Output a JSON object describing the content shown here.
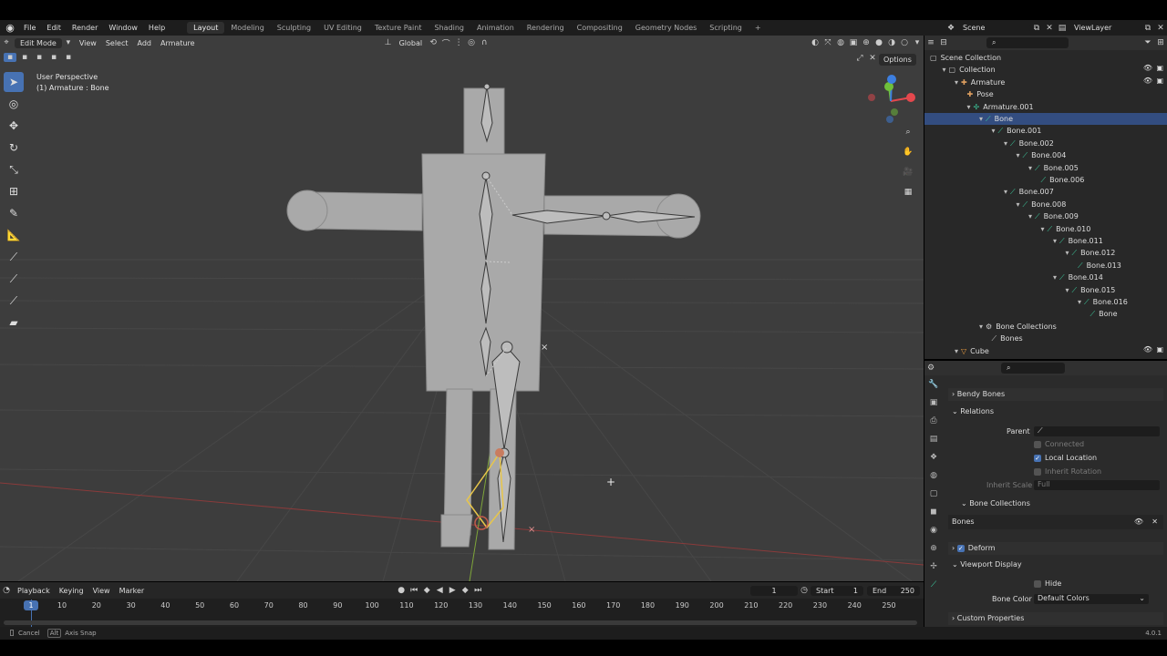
{
  "menu": {
    "items": [
      "File",
      "Edit",
      "Render",
      "Window",
      "Help"
    ],
    "workspaces": [
      "Layout",
      "Modeling",
      "Sculpting",
      "UV Editing",
      "Texture Paint",
      "Shading",
      "Animation",
      "Rendering",
      "Compositing",
      "Geometry Nodes",
      "Scripting"
    ],
    "active_workspace": "Layout",
    "add_tab": "+"
  },
  "scene": {
    "label": "Scene",
    "view_layer": "ViewLayer"
  },
  "viewport": {
    "mode": "Edit Mode",
    "menus": [
      "View",
      "Select",
      "Add",
      "Armature"
    ],
    "orientation": "Global",
    "info_line1": "User Perspective",
    "info_line2": "(1) Armature : Bone",
    "options": "Options",
    "gizmo_x_color": "#e5484d",
    "gizmo_y_color": "#6fbf3a",
    "gizmo_z_color": "#3d7fe0"
  },
  "outliner": {
    "rows": [
      {
        "label": "Scene Collection",
        "depth": 0,
        "icon": "collection-icon"
      },
      {
        "label": "Collection",
        "depth": 1,
        "icon": "collection-icon",
        "arrow": true
      },
      {
        "label": "Armature",
        "depth": 2,
        "icon": "armature-icon",
        "arrow": true
      },
      {
        "label": "Pose",
        "depth": 3,
        "icon": "pose-icon"
      },
      {
        "label": "Armature.001",
        "depth": 3,
        "icon": "armature-data-icon",
        "arrow": true
      },
      {
        "label": "Bone",
        "depth": 4,
        "icon": "bone-icon",
        "arrow": true,
        "selected": true
      },
      {
        "label": "Bone.001",
        "depth": 5,
        "icon": "bone-icon",
        "arrow": true
      },
      {
        "label": "Bone.002",
        "depth": 6,
        "icon": "bone-icon",
        "arrow": true
      },
      {
        "label": "Bone.004",
        "depth": 7,
        "icon": "bone-icon",
        "arrow": true
      },
      {
        "label": "Bone.005",
        "depth": 8,
        "icon": "bone-icon",
        "arrow": true
      },
      {
        "label": "Bone.006",
        "depth": 9,
        "icon": "bone-icon"
      },
      {
        "label": "Bone.007",
        "depth": 6,
        "icon": "bone-icon",
        "arrow": true
      },
      {
        "label": "Bone.008",
        "depth": 7,
        "icon": "bone-icon",
        "arrow": true
      },
      {
        "label": "Bone.009",
        "depth": 8,
        "icon": "bone-icon",
        "arrow": true
      },
      {
        "label": "Bone.010",
        "depth": 9,
        "icon": "bone-icon",
        "arrow": true
      },
      {
        "label": "Bone.011",
        "depth": 10,
        "icon": "bone-icon",
        "arrow": true
      },
      {
        "label": "Bone.012",
        "depth": 11,
        "icon": "bone-icon",
        "arrow": true
      },
      {
        "label": "Bone.013",
        "depth": 12,
        "icon": "bone-icon"
      },
      {
        "label": "Bone.014",
        "depth": 10,
        "icon": "bone-icon",
        "arrow": true
      },
      {
        "label": "Bone.015",
        "depth": 11,
        "icon": "bone-icon",
        "arrow": true
      },
      {
        "label": "Bone.016",
        "depth": 12,
        "icon": "bone-icon",
        "arrow": true
      },
      {
        "label": "Bone",
        "depth": 13,
        "icon": "bone-icon"
      },
      {
        "label": "Bone Collections",
        "depth": 4,
        "icon": "bone-collection-icon",
        "arrow": true
      },
      {
        "label": "Bones",
        "depth": 5,
        "icon": "bones-icon"
      },
      {
        "label": "Cube",
        "depth": 2,
        "icon": "mesh-icon",
        "arrow": true
      }
    ]
  },
  "properties": {
    "bendy_bones": "Bendy Bones",
    "relations": "Relations",
    "parent_label": "Parent",
    "connected": "Connected",
    "local_location": "Local Location",
    "inherit_rotation": "Inherit Rotation",
    "inherit_scale_label": "Inherit Scale",
    "inherit_scale_value": "Full",
    "bone_collections": "Bone Collections",
    "bones_entry": "Bones",
    "deform": "Deform",
    "viewport_display": "Viewport Display",
    "hide": "Hide",
    "bone_color_label": "Bone Color",
    "bone_color_value": "Default Colors",
    "custom_properties": "Custom Properties"
  },
  "timeline": {
    "menus": [
      "Playback",
      "Keying",
      "View",
      "Marker"
    ],
    "current_frame": "1",
    "start_label": "Start",
    "start_value": "1",
    "end_label": "End",
    "end_value": "250",
    "ticks": [
      "1",
      "10",
      "20",
      "30",
      "40",
      "50",
      "60",
      "70",
      "80",
      "90",
      "100",
      "110",
      "120",
      "130",
      "140",
      "150",
      "160",
      "170",
      "180",
      "190",
      "200",
      "210",
      "220",
      "230",
      "240",
      "250"
    ]
  },
  "status": {
    "cancel": "Cancel",
    "alt_key": "Alt",
    "axis_snap": "Axis Snap",
    "version": "4.0.1"
  }
}
